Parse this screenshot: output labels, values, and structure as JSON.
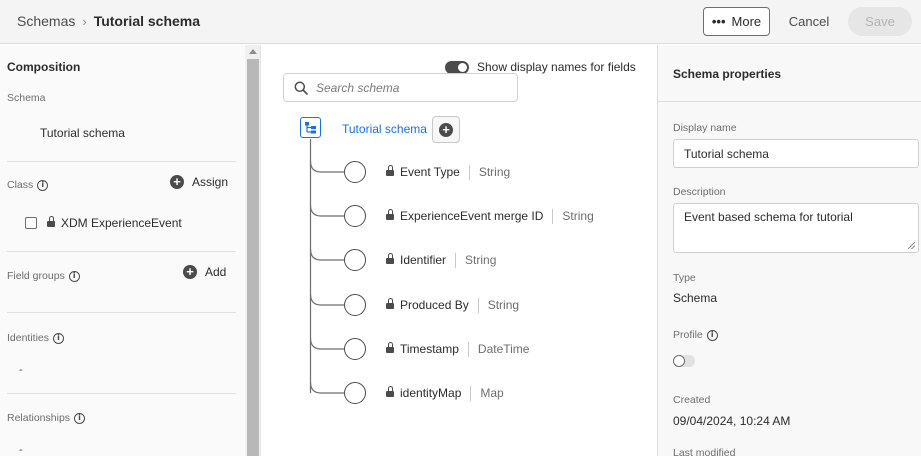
{
  "header": {
    "breadcrumb_root": "Schemas",
    "breadcrumb_separator": "›",
    "breadcrumb_current": "Tutorial schema",
    "more_label": "More",
    "more_icon": "ellipsis-icon",
    "cancel_label": "Cancel",
    "save_label": "Save"
  },
  "composition": {
    "title": "Composition",
    "schema_label": "Schema",
    "schema_name": "Tutorial schema",
    "class_label": "Class",
    "assign_label": "Assign",
    "class_item": "XDM ExperienceEvent",
    "field_groups_label": "Field groups",
    "add_label": "Add",
    "identities_label": "Identities",
    "identities_value": "-",
    "relationships_label": "Relationships",
    "relationships_value": "-"
  },
  "canvas": {
    "toggle_label": "Show display names for fields",
    "toggle_on": true,
    "search_placeholder": "Search schema",
    "root_label": "Tutorial schema",
    "fields": [
      {
        "name": "Event Type",
        "type": "String"
      },
      {
        "name": "ExperienceEvent merge ID",
        "type": "String"
      },
      {
        "name": "Identifier",
        "type": "String"
      },
      {
        "name": "Produced By",
        "type": "String"
      },
      {
        "name": "Timestamp",
        "type": "DateTime"
      },
      {
        "name": "identityMap",
        "type": "Map"
      }
    ]
  },
  "properties": {
    "title": "Schema properties",
    "display_name_label": "Display name",
    "display_name_value": "Tutorial schema",
    "description_label": "Description",
    "description_value": "Event based schema for tutorial",
    "type_label": "Type",
    "type_value": "Schema",
    "profile_label": "Profile",
    "profile_enabled": false,
    "created_label": "Created",
    "created_value": "09/04/2024, 10:24 AM",
    "last_modified_label": "Last modified"
  },
  "colors": {
    "accent": "#1473e6",
    "text": "#2c2c2c",
    "muted": "#6e6e6e"
  }
}
